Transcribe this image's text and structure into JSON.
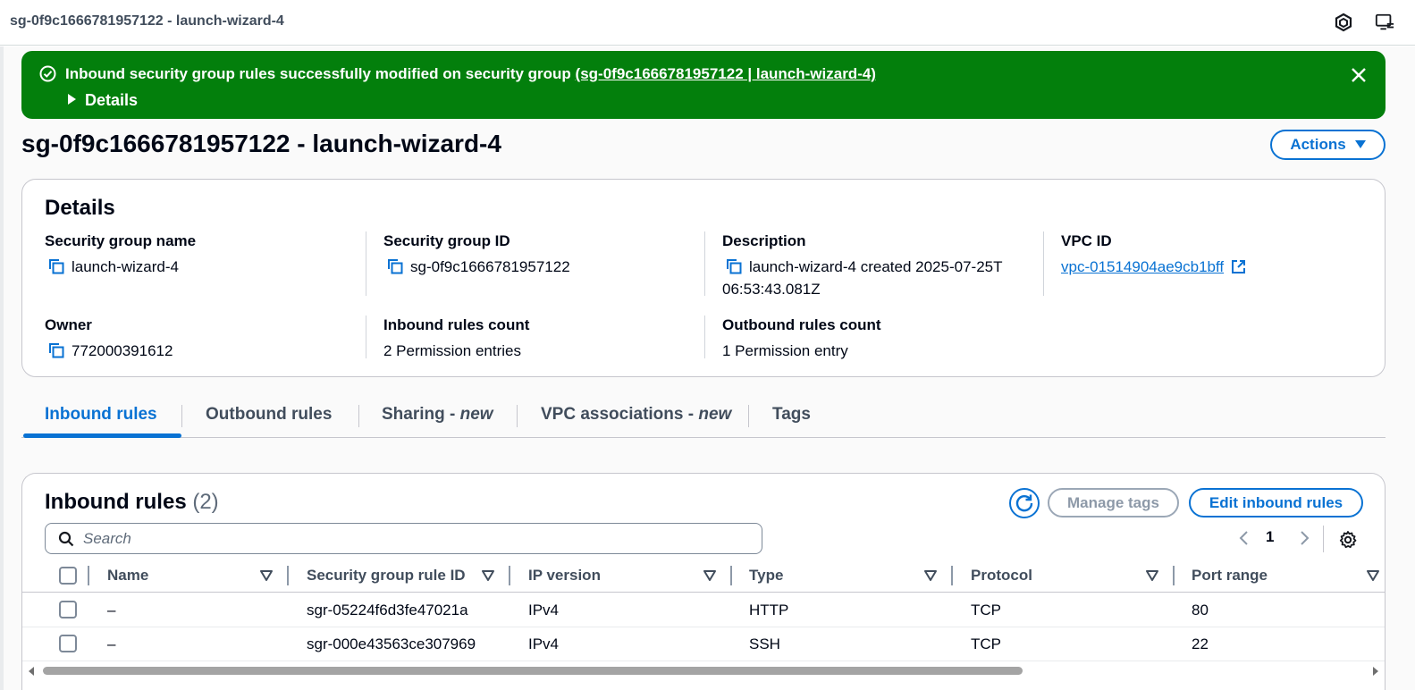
{
  "window": {
    "title": "sg-0f9c1666781957122 - launch-wizard-4",
    "icons": [
      "cube-icon",
      "remote-desktop-icon"
    ]
  },
  "flash": {
    "type": "success",
    "color": "#037f0c",
    "message": "Inbound security group rules successfully modified on security group ",
    "link": "(sg-0f9c1666781957122 | launch-wizard-4)",
    "details_label": "Details"
  },
  "page": {
    "title": "sg-0f9c1666781957122 - launch-wizard-4",
    "actions_label": "Actions"
  },
  "details": {
    "title": "Details",
    "security_group_name": {
      "label": "Security group name",
      "value": "launch-wizard-4"
    },
    "security_group_id": {
      "label": "Security group ID",
      "value": "sg-0f9c1666781957122"
    },
    "description": {
      "label": "Description",
      "value_line1": "launch-wizard-4 created 2025-07-25T",
      "value_line2": "06:53:43.081Z"
    },
    "vpc_id": {
      "label": "VPC ID",
      "value": "vpc-01514904ae9cb1bff"
    },
    "owner": {
      "label": "Owner",
      "value": "772000391612"
    },
    "inbound_rules_count": {
      "label": "Inbound rules count",
      "value": "2 Permission entries"
    },
    "outbound_rules_count": {
      "label": "Outbound rules count",
      "value": "1 Permission entry"
    }
  },
  "tabs": [
    {
      "label": "Inbound rules",
      "suffix": "",
      "active": true
    },
    {
      "label": "Outbound rules",
      "suffix": "",
      "active": false
    },
    {
      "label": "Sharing - ",
      "suffix": "new",
      "active": false
    },
    {
      "label": "VPC associations - ",
      "suffix": "new",
      "active": false
    },
    {
      "label": "Tags",
      "suffix": "",
      "active": false
    }
  ],
  "inbound": {
    "title": "Inbound rules",
    "count": "(2)",
    "manage_tags_label": "Manage tags",
    "edit_label": "Edit inbound rules",
    "search_placeholder": "Search",
    "page_number": "1",
    "columns": [
      "Name",
      "Security group rule ID",
      "IP version",
      "Type",
      "Protocol",
      "Port range"
    ],
    "rows": [
      {
        "name": "–",
        "rule_id": "sgr-05224f6d3fe47021a",
        "ip_version": "IPv4",
        "type": "HTTP",
        "protocol": "TCP",
        "port_range": "80"
      },
      {
        "name": "–",
        "rule_id": "sgr-000e43563ce307969",
        "ip_version": "IPv4",
        "type": "SSH",
        "protocol": "TCP",
        "port_range": "22"
      }
    ]
  },
  "colors": {
    "accent": "#0972d3",
    "success": "#037f0c"
  }
}
